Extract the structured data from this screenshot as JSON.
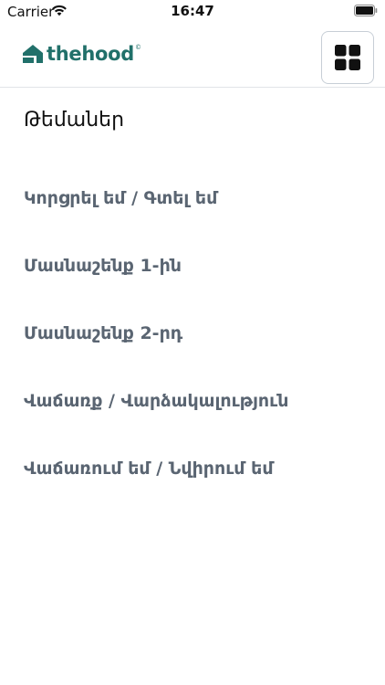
{
  "status_bar": {
    "carrier": "Carrier",
    "time": "16:47"
  },
  "header": {
    "logo_text": "thehood",
    "logo_mark": "©",
    "menu_icon": "grid-icon"
  },
  "section": {
    "title": "Թեմաներ"
  },
  "topics": [
    {
      "label": "Կորցրել եմ / Գտել եմ"
    },
    {
      "label": "Մասնաշենք 1-ին"
    },
    {
      "label": "Մասնաշենք 2-րդ"
    },
    {
      "label": "Վաճառք / Վարձակալություն"
    },
    {
      "label": "Վաճառում եմ / Նվիրում եմ"
    }
  ],
  "colors": {
    "brand": "#21706a",
    "topic_text": "#5a6572",
    "divider": "#e1e4e8"
  }
}
